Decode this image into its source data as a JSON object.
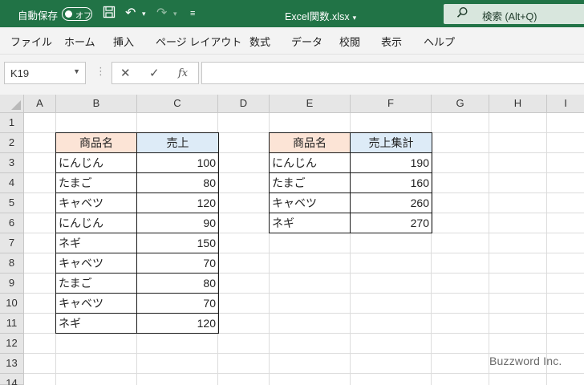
{
  "titlebar": {
    "autosave_label": "自動保存",
    "autosave_state": "オフ",
    "doc_title": "Excel関数.xlsx",
    "search_placeholder": "検索 (Alt+Q)",
    "accent": "#217346",
    "icons": {
      "save": "save-icon",
      "undo": "undo-icon",
      "redo": "redo-icon",
      "customize": "customize-qat-icon",
      "search": "search-icon"
    }
  },
  "ribbon": {
    "tabs": [
      "ファイル",
      "ホーム",
      "挿入",
      "ページ レイアウト",
      "数式",
      "データ",
      "校閲",
      "表示",
      "ヘルプ"
    ]
  },
  "formula_bar": {
    "name_box": "K19",
    "formula": ""
  },
  "sheet": {
    "columns": [
      "A",
      "B",
      "C",
      "D",
      "E",
      "F",
      "G",
      "H",
      "I"
    ],
    "rows": [
      "1",
      "2",
      "3",
      "4",
      "5",
      "6",
      "7",
      "8",
      "9",
      "10",
      "11",
      "12",
      "13",
      "14"
    ],
    "table1": {
      "headers": [
        "商品名",
        "売上"
      ],
      "rows": [
        [
          "にんじん",
          "100"
        ],
        [
          "たまご",
          "80"
        ],
        [
          "キャベツ",
          "120"
        ],
        [
          "にんじん",
          "90"
        ],
        [
          "ネギ",
          "150"
        ],
        [
          "キャベツ",
          "70"
        ],
        [
          "たまご",
          "80"
        ],
        [
          "キャベツ",
          "70"
        ],
        [
          "ネギ",
          "120"
        ]
      ]
    },
    "table2": {
      "headers": [
        "商品名",
        "売上集計"
      ],
      "rows": [
        [
          "にんじん",
          "190"
        ],
        [
          "たまご",
          "160"
        ],
        [
          "キャベツ",
          "260"
        ],
        [
          "ネギ",
          "270"
        ]
      ]
    },
    "header_colors": {
      "name": "#fce4d6",
      "value": "#ddebf7"
    }
  },
  "watermark": "Buzzword Inc."
}
